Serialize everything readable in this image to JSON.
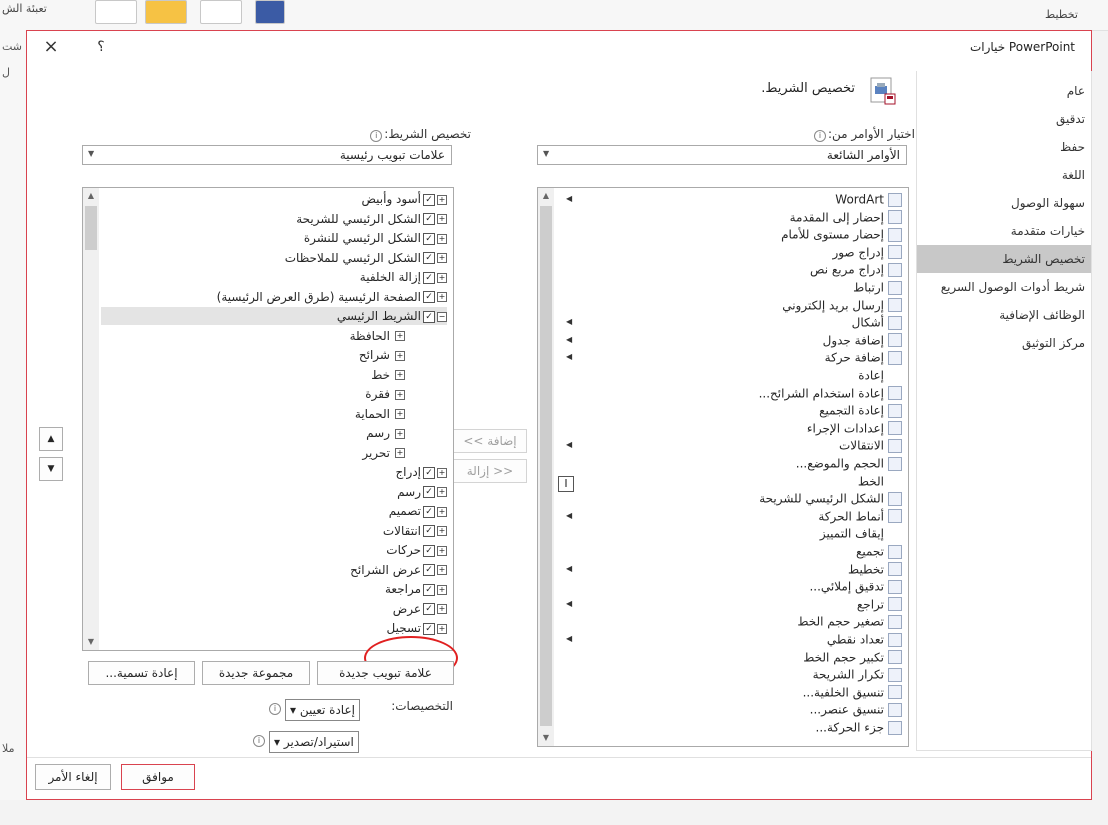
{
  "background": {
    "ribbon_labels": [
      "تعبئة الش",
      "تخطيط"
    ],
    "side_labels": [
      "شت",
      "ل",
      "ملا"
    ]
  },
  "dialog": {
    "title": "خيارات PowerPoint",
    "close_glyph": "×",
    "help_glyph": "؟"
  },
  "nav": {
    "items": [
      "عام",
      "تدقيق",
      "حفظ",
      "اللغة",
      "سهولة الوصول",
      "خيارات متقدمة",
      "تخصيص الشريط",
      "شريط أدوات الوصول السريع",
      "الوظائف الإضافية",
      "مركز التوثيق"
    ],
    "selected_index": 6
  },
  "main": {
    "title": "تخصيص الشريط.",
    "commands_from_label": "اختيار الأوامر من:",
    "commands_from_value": "الأوامر الشائعة",
    "customize_label": "تخصيص الشريط:",
    "customize_value": "علامات تبويب رئيسية"
  },
  "commands": [
    {
      "label": "WordArt",
      "icon": "wordart-icon",
      "sub": true
    },
    {
      "label": "إحضار إلى المقدمة",
      "icon": "bring-front-icon",
      "sub": false
    },
    {
      "label": "إحضار مستوى للأمام",
      "icon": "bring-forward-icon",
      "sub": false
    },
    {
      "label": "إدراج صور",
      "icon": "insert-pictures-icon",
      "sub": false
    },
    {
      "label": "إدراج مربع نص",
      "icon": "textbox-icon",
      "sub": false
    },
    {
      "label": "ارتباط",
      "icon": "link-icon",
      "sub": false
    },
    {
      "label": "إرسال بريد إلكتروني",
      "icon": "email-icon",
      "sub": false
    },
    {
      "label": "أشكال",
      "icon": "shapes-icon",
      "sub": true
    },
    {
      "label": "إضافة جدول",
      "icon": "table-icon",
      "sub": true
    },
    {
      "label": "إضافة حركة",
      "icon": "add-animation-icon",
      "sub": true
    },
    {
      "label": "إعادة",
      "icon": "",
      "sub": false
    },
    {
      "label": "إعادة استخدام الشرائح...",
      "icon": "reuse-slides-icon",
      "sub": false
    },
    {
      "label": "إعادة التجميع",
      "icon": "regroup-icon",
      "sub": false
    },
    {
      "label": "إعدادات الإجراء",
      "icon": "action-icon",
      "sub": false
    },
    {
      "label": "الانتقالات",
      "icon": "transitions-icon",
      "sub": true
    },
    {
      "label": "الحجم والموضع...",
      "icon": "size-position-icon",
      "sub": false
    },
    {
      "label": "الخط",
      "icon": "",
      "sub": false
    },
    {
      "label": "الشكل الرئيسي للشريحة",
      "icon": "slide-master-icon",
      "sub": false
    },
    {
      "label": "أنماط الحركة",
      "icon": "animation-styles-icon",
      "sub": true
    },
    {
      "label": "إيقاف التمييز",
      "icon": "",
      "sub": false
    },
    {
      "label": "تجميع",
      "icon": "group-icon",
      "sub": false
    },
    {
      "label": "تخطيط",
      "icon": "layout-icon",
      "sub": true
    },
    {
      "label": "تدقيق إملائي...",
      "icon": "spelling-icon",
      "sub": false
    },
    {
      "label": "تراجع",
      "icon": "undo-icon",
      "sub": true
    },
    {
      "label": "تصغير حجم الخط",
      "icon": "font-decrease-icon",
      "sub": false
    },
    {
      "label": "تعداد نقطي",
      "icon": "bullets-icon",
      "sub": true
    },
    {
      "label": "تكبير حجم الخط",
      "icon": "font-increase-icon",
      "sub": false
    },
    {
      "label": "تكرار الشريحة",
      "icon": "duplicate-slide-icon",
      "sub": false
    },
    {
      "label": "تنسيق الخلفية...",
      "icon": "format-background-icon",
      "sub": false
    },
    {
      "label": "تنسيق عنصر...",
      "icon": "format-object-icon",
      "sub": false
    },
    {
      "label": "جزء الحركة...",
      "icon": "animation-pane-icon",
      "sub": false
    }
  ],
  "font_field_glyph": "I",
  "tree": [
    {
      "label": "أسود وأبيض",
      "level": 0,
      "pm": "+",
      "checked": true,
      "sel": false
    },
    {
      "label": "الشكل الرئيسي للشريحة",
      "level": 0,
      "pm": "+",
      "checked": true,
      "sel": false
    },
    {
      "label": "الشكل الرئيسي للنشرة",
      "level": 0,
      "pm": "+",
      "checked": true,
      "sel": false
    },
    {
      "label": "الشكل الرئيسي للملاحظات",
      "level": 0,
      "pm": "+",
      "checked": true,
      "sel": false
    },
    {
      "label": "إزالة الخلفية",
      "level": 0,
      "pm": "+",
      "checked": true,
      "sel": false
    },
    {
      "label": "الصفحة الرئيسية (طرق العرض الرئيسية)",
      "level": 0,
      "pm": "+",
      "checked": true,
      "sel": false
    },
    {
      "label": "الشريط الرئيسي",
      "level": 0,
      "pm": "−",
      "checked": true,
      "sel": true
    },
    {
      "label": "الحافظة",
      "level": 1,
      "pm": "+",
      "checked": null,
      "sel": false
    },
    {
      "label": "شرائح",
      "level": 1,
      "pm": "+",
      "checked": null,
      "sel": false
    },
    {
      "label": "خط",
      "level": 1,
      "pm": "+",
      "checked": null,
      "sel": false
    },
    {
      "label": "فقرة",
      "level": 1,
      "pm": "+",
      "checked": null,
      "sel": false
    },
    {
      "label": "الحماية",
      "level": 1,
      "pm": "+",
      "checked": null,
      "sel": false
    },
    {
      "label": "رسم",
      "level": 1,
      "pm": "+",
      "checked": null,
      "sel": false
    },
    {
      "label": "تحرير",
      "level": 1,
      "pm": "+",
      "checked": null,
      "sel": false
    },
    {
      "label": "إدراج",
      "level": 0,
      "pm": "+",
      "checked": true,
      "sel": false
    },
    {
      "label": "رسم",
      "level": 0,
      "pm": "+",
      "checked": true,
      "sel": false
    },
    {
      "label": "تصميم",
      "level": 0,
      "pm": "+",
      "checked": true,
      "sel": false
    },
    {
      "label": "انتقالات",
      "level": 0,
      "pm": "+",
      "checked": true,
      "sel": false
    },
    {
      "label": "حركات",
      "level": 0,
      "pm": "+",
      "checked": true,
      "sel": false
    },
    {
      "label": "عرض الشرائح",
      "level": 0,
      "pm": "+",
      "checked": true,
      "sel": false
    },
    {
      "label": "مراجعة",
      "level": 0,
      "pm": "+",
      "checked": true,
      "sel": false
    },
    {
      "label": "عرض",
      "level": 0,
      "pm": "+",
      "checked": true,
      "sel": false
    },
    {
      "label": "تسجيل",
      "level": 0,
      "pm": "+",
      "checked": true,
      "sel": false
    }
  ],
  "buttons": {
    "add": "إضافة >>",
    "remove": "<< إزالة",
    "new_tab": "علامة تبويب جديدة",
    "new_group": "مجموعة جديدة",
    "rename": "إعادة تسمية...",
    "ok": "موافق",
    "cancel": "إلغاء الأمر",
    "move_up": "▲",
    "move_down": "▼"
  },
  "customizations": {
    "label": "التخصيصات:",
    "reset": "إعادة تعيين ▾",
    "import_export": "استيراد/تصدير ▾"
  },
  "colors": {
    "accent_border": "#d9434f",
    "selection": "#c8c8c8",
    "annotation": "#e02020"
  }
}
